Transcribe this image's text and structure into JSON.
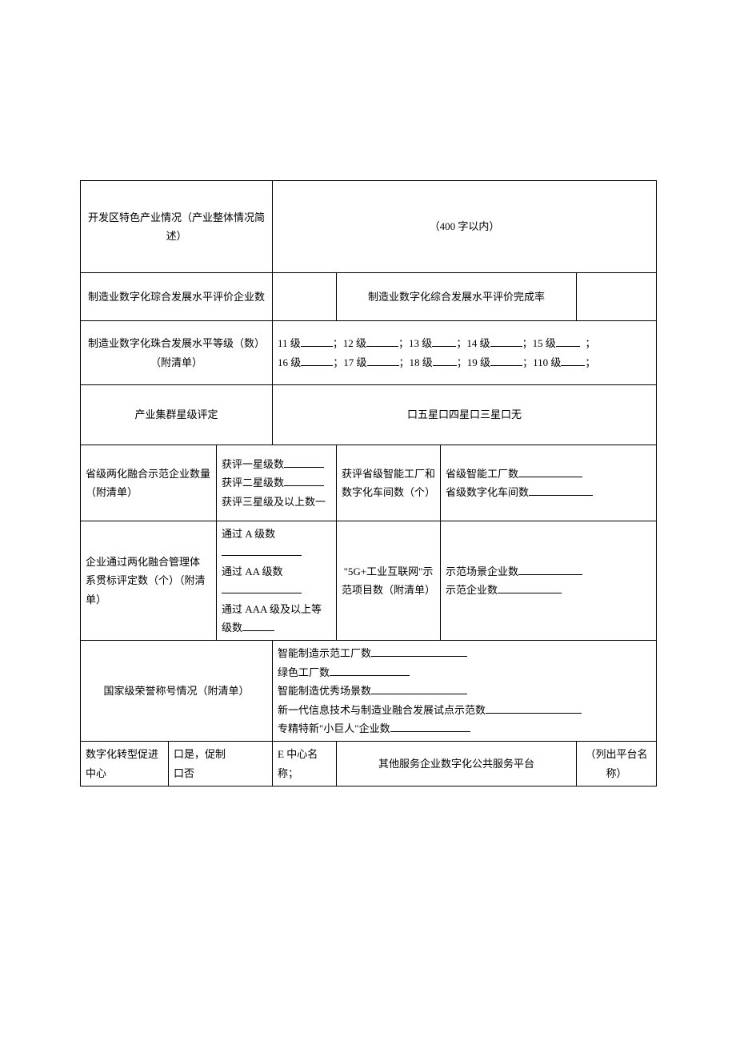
{
  "row1": {
    "label": "开发区特色产业情况（产业整体情况简述）",
    "hint": "（400 字以内）"
  },
  "row2": {
    "label": "制造业数字化琮合发展水平评价企业数",
    "right_label": "制造业数字化综合发展水平评价完成率"
  },
  "row3": {
    "label": "制造业数字化珠合发展水平等级（数）（附清单）",
    "line1_a": "11 级",
    "line1_b": "；12 级",
    "line1_c": "；13 级",
    "line1_d": "；14 级",
    "line1_e": "；15 级",
    "line1_f": "；",
    "line2_a": "16 级",
    "line2_b": "；17 级",
    "line2_c": "；18 级",
    "line2_d": "；19 级",
    "line2_e": "；110 级",
    "line2_f": "；"
  },
  "row4": {
    "label": "产业集群星级评定",
    "prefix": "口五星口四星口三星口无"
  },
  "row5": {
    "left_label": "省级两化融合示范企业数量（附清单）",
    "mid_line1": "获评一星级数",
    "mid_line2": "获评二星级数",
    "mid_line3": "获评三星级及以上数一",
    "r_label": "获评省级智能工厂和数字化车间数（个）",
    "rr_line1": "省级智能工厂数",
    "rr_line2": "省级数字化车间数"
  },
  "row6": {
    "left_label": "企业通过两化融合管理体 系贯标评定数（个）（附清单）",
    "mid_line1": "通过 A 级数",
    "mid_line2": "通过 AA 级数",
    "mid_line3": "通过 AAA 级及以上等级数",
    "r_label": "\"5G+工业互联网\"示范项目数（附清单）",
    "rr_line1": "示范场景企业数",
    "rr_line2": "示范企业数"
  },
  "row7": {
    "label": "国家级荣誉称号情况（附清单）",
    "l1": "智能制造示范工厂数",
    "l2": "绿色工厂数",
    "l3": "智能制造优秀场景数",
    "l4": "新一代信息技术与制造业融合发展试点示范数",
    "l5": "专精特新\"小巨人\"企业数"
  },
  "row8": {
    "c1": "数字化转型促进中心",
    "c2a": "口是，促制",
    "c2b": "口否",
    "c3": "E 中心名称；",
    "c4": "其他服务企业数字化公共服务平台",
    "c5": "（列出平台名称）"
  }
}
